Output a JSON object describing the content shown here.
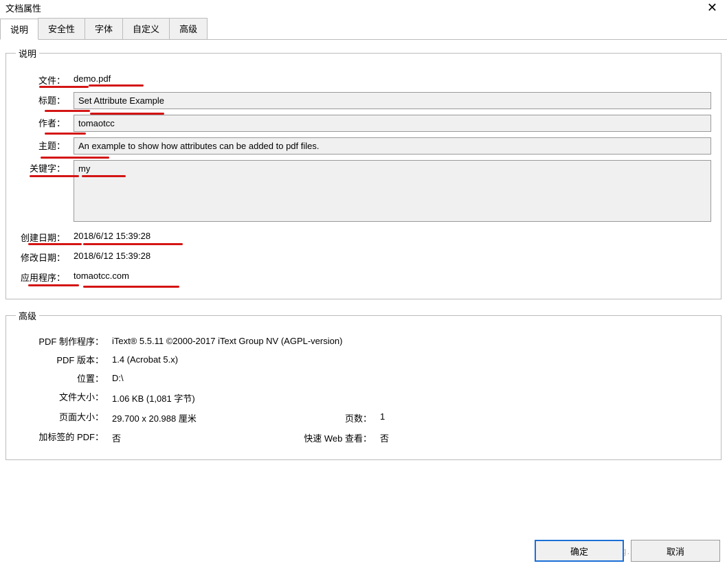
{
  "window": {
    "title": "文档属性",
    "close_glyph": "✕"
  },
  "tabs": {
    "description": "说明",
    "security": "安全性",
    "fonts": "字体",
    "custom": "自定义",
    "advanced": "高级"
  },
  "section_description": {
    "legend": "说明",
    "fields": {
      "file_label": "文件：",
      "file_value": "demo.pdf",
      "title_label": "标题：",
      "title_value": "Set Attribute Example",
      "author_label": "作者：",
      "author_value": "tomaotcc",
      "subject_label": "主题：",
      "subject_value": "An example to show how attributes can be added to pdf files.",
      "keywords_label": "关键字：",
      "keywords_value": "my",
      "created_label": "创建日期：",
      "created_value": "2018/6/12 15:39:28",
      "modified_label": "修改日期：",
      "modified_value": "2018/6/12 15:39:28",
      "application_label": "应用程序：",
      "application_value": "tomaotcc.com"
    }
  },
  "section_advanced": {
    "legend": "高级",
    "fields": {
      "producer_label": "PDF 制作程序：",
      "producer_value": "iText® 5.5.11 ©2000-2017 iText Group NV (AGPL-version)",
      "version_label": "PDF 版本：",
      "version_value": "1.4 (Acrobat 5.x)",
      "location_label": "位置：",
      "location_value": "D:\\",
      "filesize_label": "文件大小：",
      "filesize_value": "1.06 KB  (1,081 字节)",
      "pagesize_label": "页面大小：",
      "pagesize_value": "29.700 x 20.988 厘米",
      "pages_label": "页数：",
      "pages_value": "1",
      "tagged_label": "加标签的 PDF：",
      "tagged_value": "否",
      "fastweb_label": "快速 Web 查看：",
      "fastweb_value": "否"
    }
  },
  "buttons": {
    "ok": "确定",
    "cancel": "取消"
  },
  "watermark": "https://blog.csdn.net/tomaotcc"
}
